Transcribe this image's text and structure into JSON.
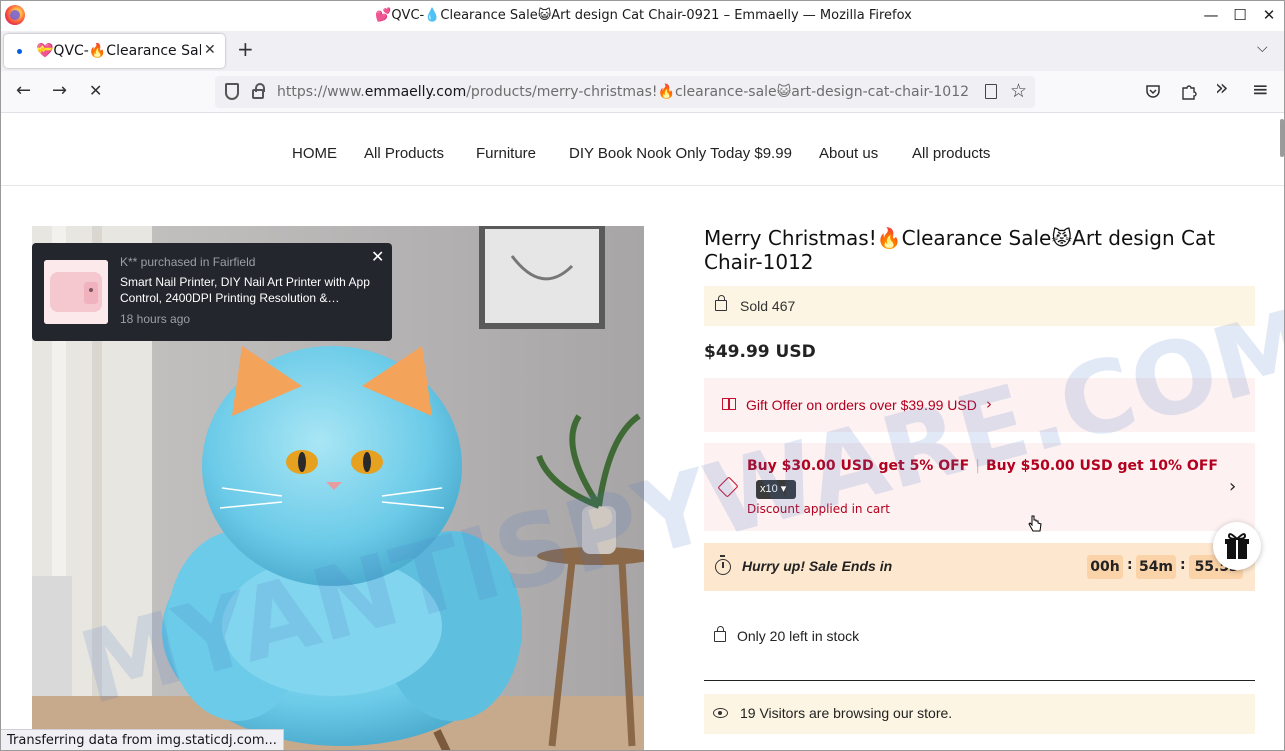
{
  "window": {
    "title": "💕QVC-💧Clearance Sale😺Art design Cat Chair-0921 – Emmaelly — Mozilla Firefox",
    "minimize": "—",
    "maximize": "☐",
    "close": "✕"
  },
  "tab": {
    "label": "💝QVC-🔥Clearance Sale",
    "close": "✕",
    "new_tab": "+",
    "list_all": "⌵"
  },
  "navbar": {
    "url_prefix": "https://www.",
    "url_domain": "emmaelly.com",
    "url_path": "/products/merry-christmas!🔥clearance-sale😺art-design-cat-chair-1012",
    "back": "←",
    "forward": "→",
    "stop": "✕",
    "bookmark": "☆",
    "extensions": "»",
    "menu": "≡"
  },
  "site_nav": {
    "items": [
      "HOME",
      "All Products",
      "Furniture",
      "DIY Book Nook Only Today $9.99",
      "About us",
      "All products"
    ]
  },
  "toast": {
    "who": "K** purchased in Fairfield",
    "product": "Smart Nail Printer, DIY Nail Art Printer with App Control, 2400DPI Printing Resolution &…",
    "time": "18 hours ago",
    "close": "✕"
  },
  "product": {
    "title": "Merry Christmas!🔥Clearance Sale😾Art design Cat Chair-1012",
    "sold": "Sold 467",
    "price": "$49.99 USD",
    "gift_offer": "Gift Offer on orders over $39.99 USD",
    "gift_arrow": "›",
    "discount_1": "Buy $30.00 USD get 5% OFF",
    "discount_sep": "|",
    "discount_2": "Buy $50.00 USD get 10% OFF",
    "discount_qty": "x10 ▾",
    "discount_applied": "Discount applied in cart",
    "discount_arrow": "›",
    "hurry": "Hurry up! Sale Ends in",
    "countdown": {
      "hours": "00h",
      "minutes": "54m",
      "seconds": "55.5s",
      "sep": ":"
    },
    "stock": "Only 20 left in stock",
    "visitors": "19 Visitors are browsing our store."
  },
  "status_bar": "Transferring data from img.staticdj.com...",
  "watermark": "MYANTISPYWARE.COM",
  "colors": {
    "accent_red": "#b2001e",
    "sold_bg": "#fdf5e4",
    "gift_bg": "#fdf1f1",
    "hurry_bg": "#fde8cf",
    "toast_bg": "#23262d"
  }
}
